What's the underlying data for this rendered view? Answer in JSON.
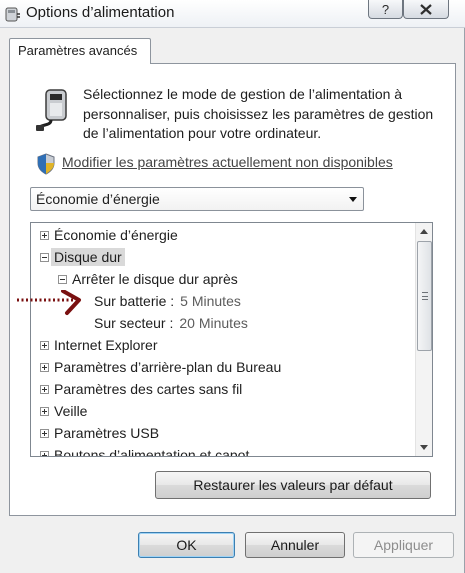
{
  "window": {
    "title": "Options d’alimentation",
    "help_label": "?"
  },
  "tab": {
    "label": "Paramètres avancés"
  },
  "description": "Sélectionnez le mode de gestion de l’alimentation à personnaliser, puis choisissez les paramètres de gestion de l’alimentation pour votre ordinateur.",
  "modify_link": "Modifier les paramètres actuellement non disponibles",
  "plan_select": {
    "value": "Économie d’énergie"
  },
  "tree": {
    "items": [
      {
        "label": "Économie d’énergie",
        "expander": "plus"
      },
      {
        "label": "Disque dur",
        "expander": "minus",
        "selected": true
      },
      {
        "label": "Arrêter le disque dur après",
        "expander": "minus"
      },
      {
        "label": "Sur batterie :",
        "value": "5 Minutes"
      },
      {
        "label": "Sur secteur :",
        "value": "20 Minutes"
      },
      {
        "label": "Internet Explorer",
        "expander": "plus"
      },
      {
        "label": "Paramètres d’arrière-plan du Bureau",
        "expander": "plus"
      },
      {
        "label": "Paramètres des cartes sans fil",
        "expander": "plus"
      },
      {
        "label": "Veille",
        "expander": "plus"
      },
      {
        "label": "Paramètres USB",
        "expander": "plus"
      },
      {
        "label": "Boutons d’alimentation et capot",
        "expander": "plus"
      }
    ]
  },
  "buttons": {
    "restore": "Restaurer les valeurs par défaut",
    "ok": "OK",
    "cancel": "Annuler",
    "apply": "Appliquer"
  },
  "colors": {
    "annotation_arrow": "#7a1010",
    "selection_bg": "#d9d9d9",
    "link": "#444444"
  },
  "icons": {
    "title": "power-options-icon",
    "header": "power-plug-battery-icon",
    "shield": "uac-shield-icon",
    "close": "close-icon",
    "dropdown": "chevron-down-icon"
  }
}
